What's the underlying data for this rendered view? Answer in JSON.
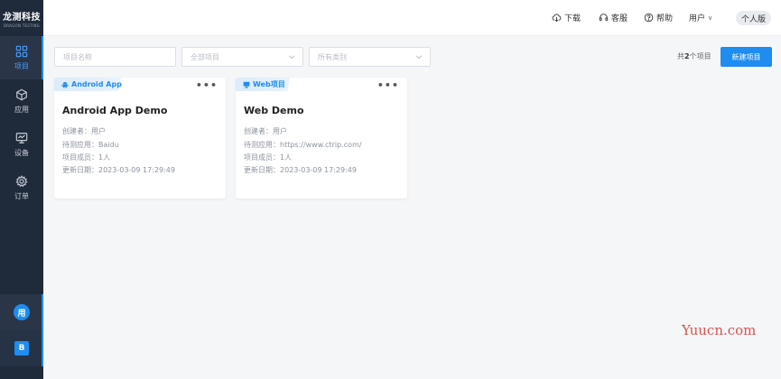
{
  "logo": {
    "main": "龙测科技",
    "sub": "DRAGON TESTING"
  },
  "sidebar": {
    "items": [
      {
        "label": "项目",
        "icon": "grid-icon",
        "active": true
      },
      {
        "label": "应用",
        "icon": "cube-icon",
        "active": false
      },
      {
        "label": "设备",
        "icon": "monitor-icon",
        "active": false
      },
      {
        "label": "订单",
        "icon": "gear-icon",
        "active": false
      }
    ],
    "avatar_text": "用",
    "doc_icon_text": "B"
  },
  "header": {
    "download": "下载",
    "service": "客服",
    "help": "帮助",
    "user": "用户",
    "edition": "个人版"
  },
  "filters": {
    "name_placeholder": "项目名称",
    "all_projects": "全部项目",
    "all_types": "所有类别"
  },
  "summary": {
    "prefix": "共",
    "count": "2",
    "suffix": "个项目"
  },
  "new_project_label": "新建项目",
  "projects": [
    {
      "tag": "Android App",
      "title": "Android App Demo",
      "creator": "创建者：用户",
      "app": "待测应用：Baidu",
      "members": "项目成员：1人",
      "updated": "更新日期：2023-03-09 17:29:49"
    },
    {
      "tag": "Web项目",
      "title": "Web Demo",
      "creator": "创建者：用户",
      "app": "待测应用：https://www.ctrip.com/",
      "members": "项目成员：1人",
      "updated": "更新日期：2023-03-09 17:29:49"
    }
  ],
  "more_label": "•••",
  "watermark": "Yuucn.com",
  "colors": {
    "accent": "#1e8cf0",
    "sidebar_bg": "#1f2a3b",
    "watermark": "#d9534f"
  }
}
